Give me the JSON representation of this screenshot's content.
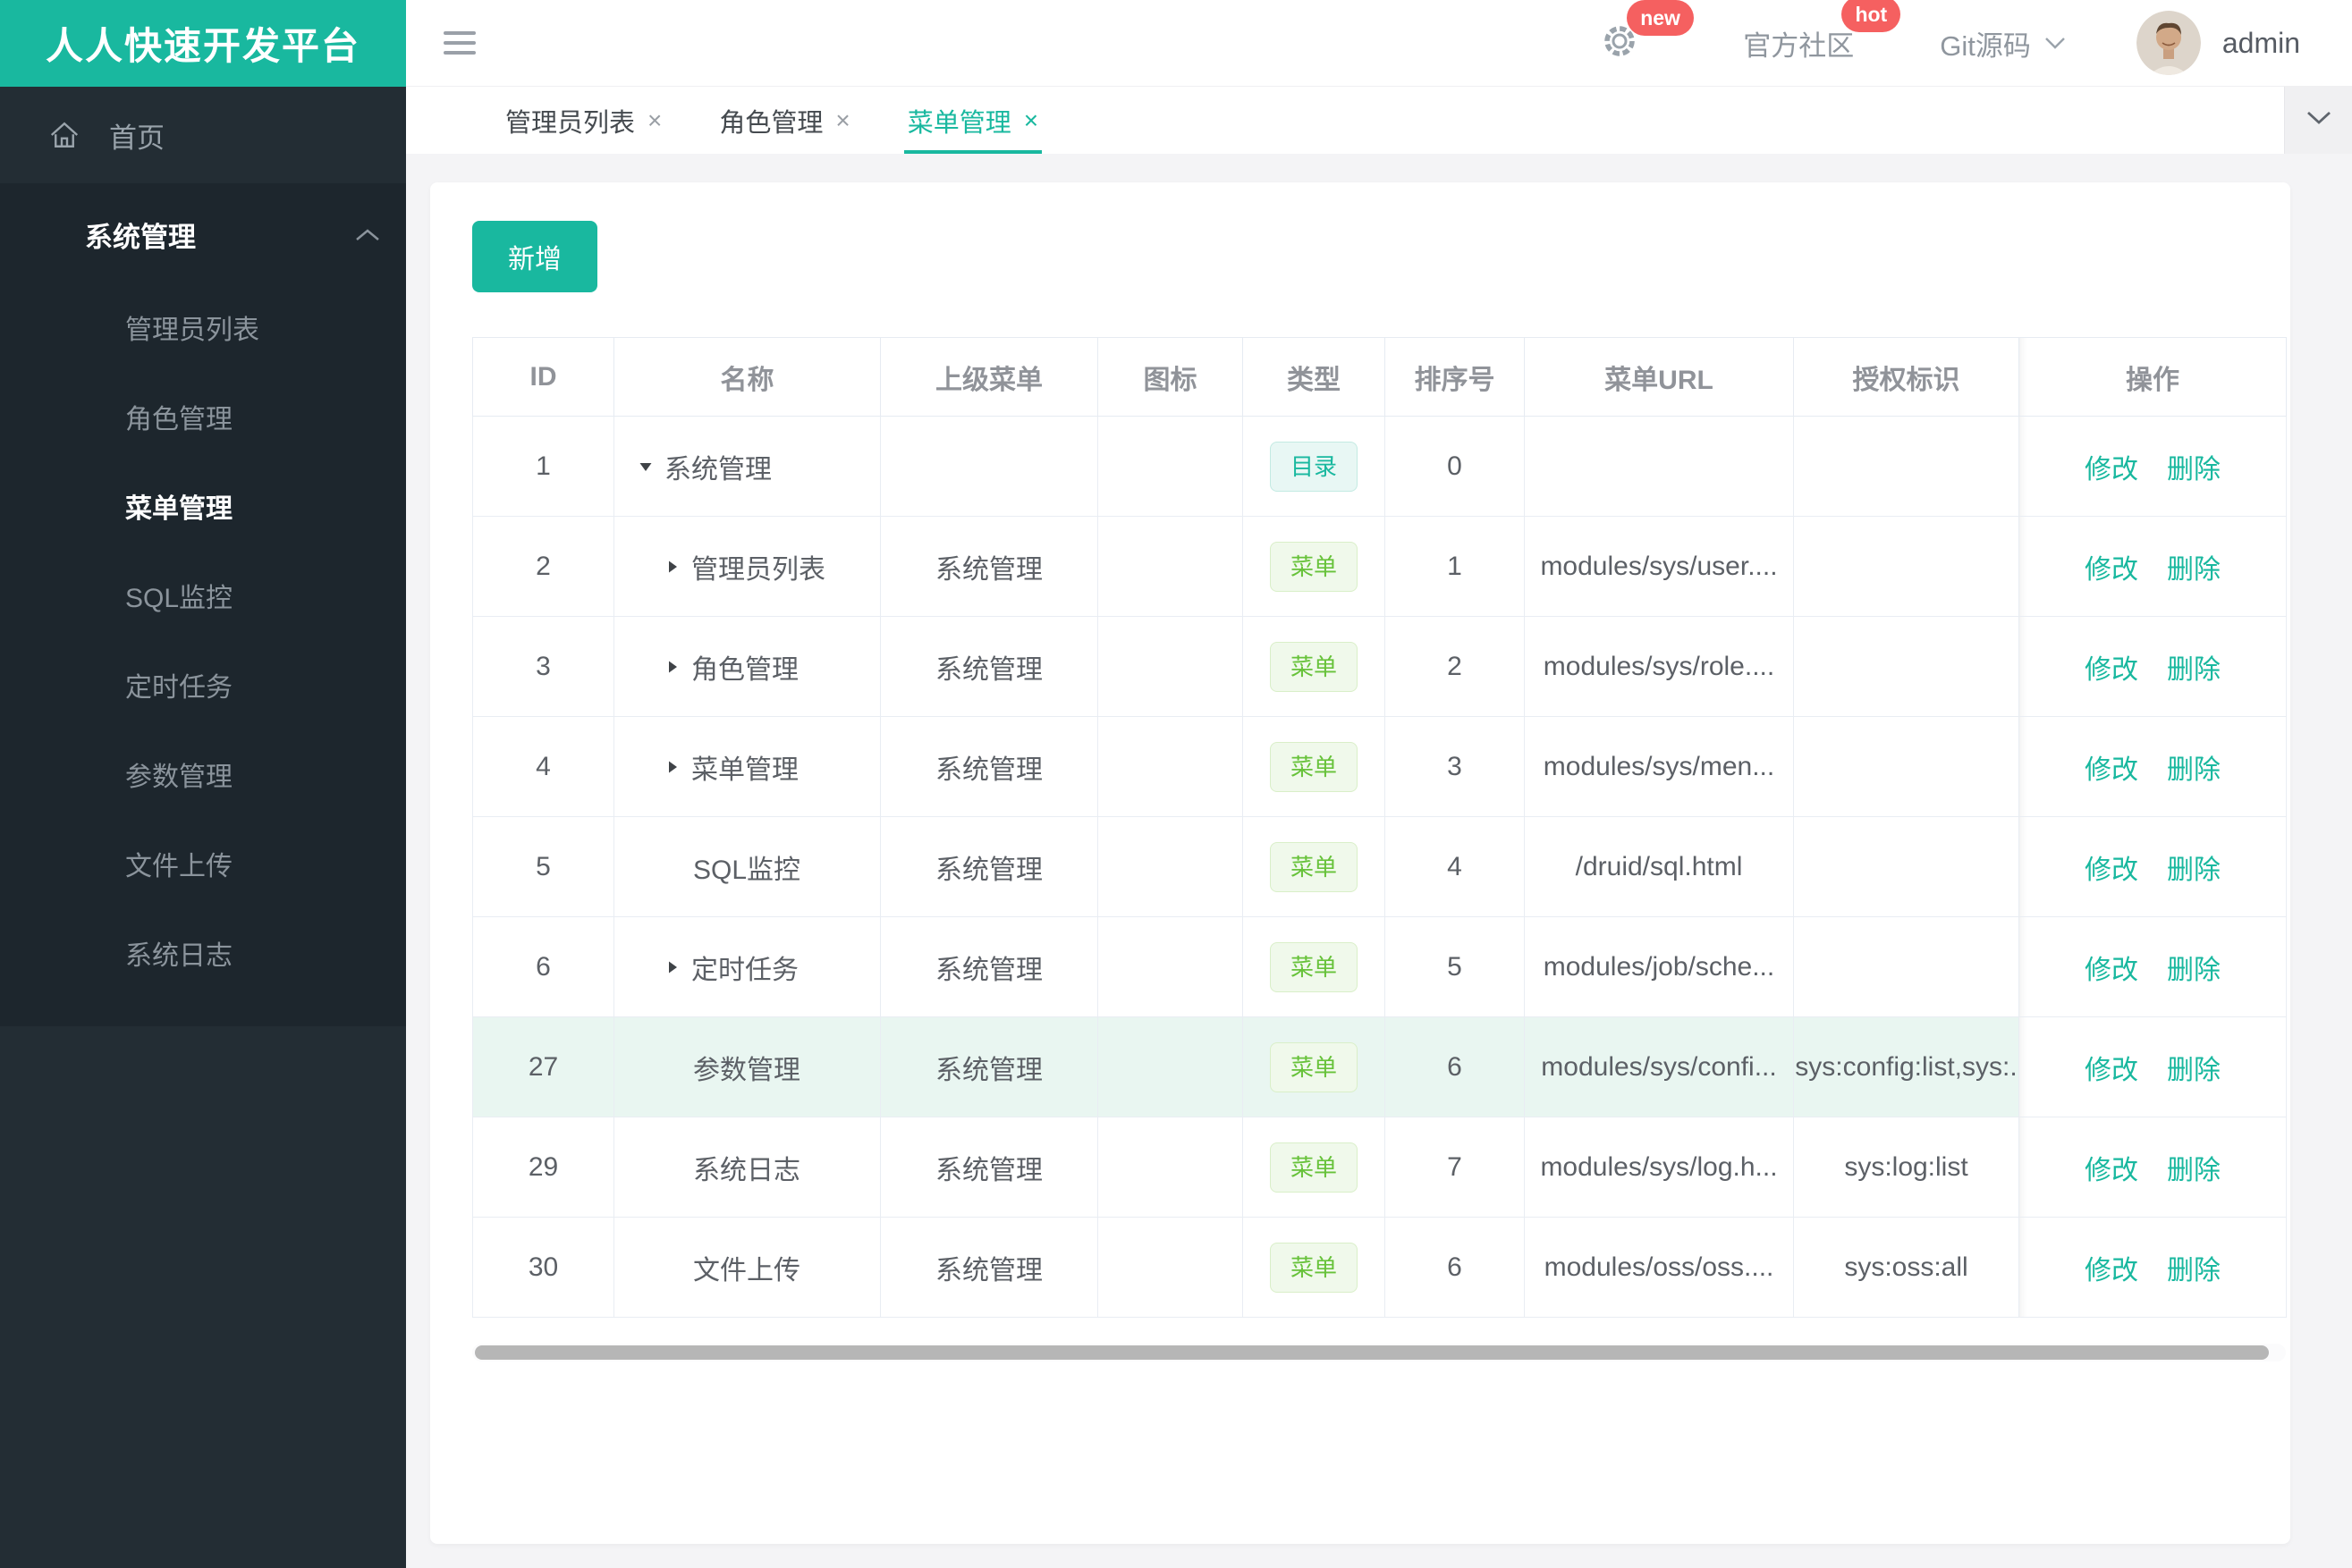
{
  "app": {
    "title": "人人快速开发平台"
  },
  "sidebar": {
    "home_label": "首页",
    "group_label": "系统管理",
    "items": [
      {
        "label": "管理员列表",
        "active": false
      },
      {
        "label": "角色管理",
        "active": false
      },
      {
        "label": "菜单管理",
        "active": true
      },
      {
        "label": "SQL监控",
        "active": false
      },
      {
        "label": "定时任务",
        "active": false
      },
      {
        "label": "参数管理",
        "active": false
      },
      {
        "label": "文件上传",
        "active": false
      },
      {
        "label": "系统日志",
        "active": false
      }
    ]
  },
  "header": {
    "gear_badge": "new",
    "community_label": "官方社区",
    "community_badge": "hot",
    "git_label": "Git源码",
    "username": "admin"
  },
  "tabs": {
    "close_glyph": "×",
    "items": [
      {
        "label": "管理员列表",
        "active": false
      },
      {
        "label": "角色管理",
        "active": false
      },
      {
        "label": "菜单管理",
        "active": true
      }
    ]
  },
  "toolbar": {
    "add_label": "新增"
  },
  "table": {
    "columns": [
      "ID",
      "名称",
      "上级菜单",
      "图标",
      "类型",
      "排序号",
      "菜单URL",
      "授权标识",
      "操作"
    ],
    "action_labels": {
      "edit": "修改",
      "delete": "删除"
    },
    "rows": [
      {
        "id": "1",
        "level": 0,
        "arrow": "down",
        "name": "系统管理",
        "parent": "",
        "icon": "",
        "type": "目录",
        "type_kind": "dir",
        "order": "0",
        "url": "",
        "perm": "",
        "highlight": false
      },
      {
        "id": "2",
        "level": 1,
        "arrow": "right",
        "name": "管理员列表",
        "parent": "系统管理",
        "icon": "",
        "type": "菜单",
        "type_kind": "menu",
        "order": "1",
        "url": "modules/sys/user....",
        "perm": "",
        "highlight": false
      },
      {
        "id": "3",
        "level": 1,
        "arrow": "right",
        "name": "角色管理",
        "parent": "系统管理",
        "icon": "",
        "type": "菜单",
        "type_kind": "menu",
        "order": "2",
        "url": "modules/sys/role....",
        "perm": "",
        "highlight": false
      },
      {
        "id": "4",
        "level": 1,
        "arrow": "right",
        "name": "菜单管理",
        "parent": "系统管理",
        "icon": "",
        "type": "菜单",
        "type_kind": "menu",
        "order": "3",
        "url": "modules/sys/men...",
        "perm": "",
        "highlight": false
      },
      {
        "id": "5",
        "level": 1,
        "arrow": "none",
        "name": "SQL监控",
        "parent": "系统管理",
        "icon": "",
        "type": "菜单",
        "type_kind": "menu",
        "order": "4",
        "url": "/druid/sql.html",
        "perm": "",
        "highlight": false
      },
      {
        "id": "6",
        "level": 1,
        "arrow": "right",
        "name": "定时任务",
        "parent": "系统管理",
        "icon": "",
        "type": "菜单",
        "type_kind": "menu",
        "order": "5",
        "url": "modules/job/sche...",
        "perm": "",
        "highlight": false
      },
      {
        "id": "27",
        "level": 1,
        "arrow": "none",
        "name": "参数管理",
        "parent": "系统管理",
        "icon": "",
        "type": "菜单",
        "type_kind": "menu",
        "order": "6",
        "url": "modules/sys/confi...",
        "perm": "sys:config:list,sys:.",
        "highlight": true
      },
      {
        "id": "29",
        "level": 1,
        "arrow": "none",
        "name": "系统日志",
        "parent": "系统管理",
        "icon": "",
        "type": "菜单",
        "type_kind": "menu",
        "order": "7",
        "url": "modules/sys/log.h...",
        "perm": "sys:log:list",
        "highlight": false
      },
      {
        "id": "30",
        "level": 1,
        "arrow": "none",
        "name": "文件上传",
        "parent": "系统管理",
        "icon": "",
        "type": "菜单",
        "type_kind": "menu",
        "order": "6",
        "url": "modules/oss/oss....",
        "perm": "sys:oss:all",
        "highlight": false
      }
    ]
  },
  "colors": {
    "primary": "#19b89f",
    "badge_red": "#f56060",
    "tag_dir_text": "#19b89f",
    "tag_menu_text": "#67c23a",
    "row_highlight": "#e9f6f1",
    "sidebar_bg": "#232d34"
  }
}
